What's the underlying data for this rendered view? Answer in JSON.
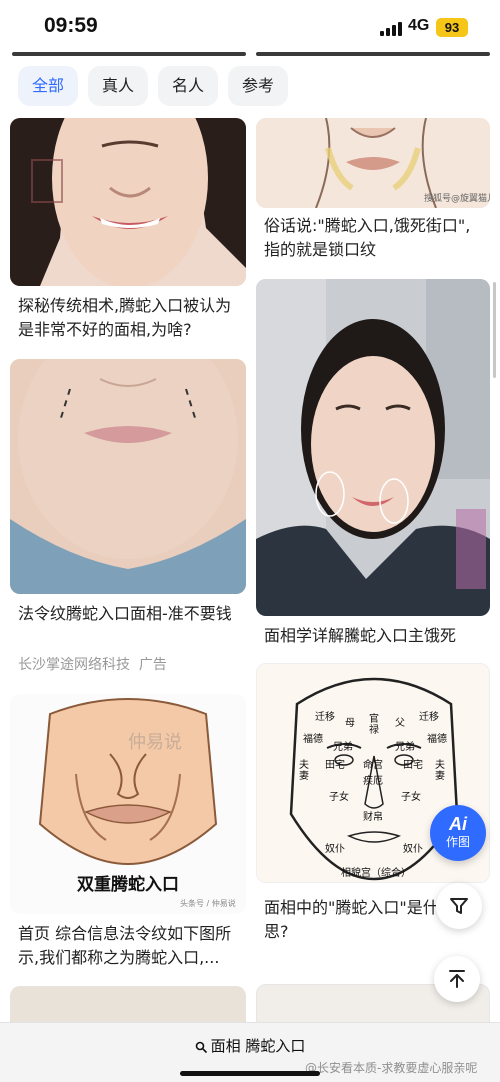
{
  "status_bar": {
    "time": "09:59",
    "network": "4G",
    "battery": "93"
  },
  "filters": [
    {
      "label": "全部",
      "active": true
    },
    {
      "label": "真人",
      "active": false
    },
    {
      "label": "名人",
      "active": false
    },
    {
      "label": "参考",
      "active": false
    }
  ],
  "cards": [
    {
      "title": "探秘传统相术,腾蛇入口被认为是非常不好的面相,为啥?",
      "image_text": ""
    },
    {
      "title": "俗话说:\"腾蛇入口,饿死街口\",指的就是锁口纹",
      "image_text": "搜狐号@旋翼猫儿"
    },
    {
      "title": "面相学详解騰蛇入口主饿死",
      "image_text": ""
    },
    {
      "title": "法令纹腾蛇入口面相-准不要钱",
      "meta": "长沙掌途网络科技  广告"
    },
    {
      "title": "面相中的\"腾蛇入口\"是什么意思?",
      "image_labels": [
        "迁移",
        "母",
        "官禄",
        "父",
        "迁移",
        "福德",
        "兄弟",
        "兄弟",
        "福德",
        "夫妻",
        "田宅",
        "命宫",
        "田宅",
        "夫妻",
        "疾厄",
        "子女",
        "子女",
        "财帛",
        "奴仆",
        "奴仆",
        "相貌宫（综合）"
      ]
    },
    {
      "title": "首页 综合信息法令纹如下图所示,我们都称之为腾蛇入口,...",
      "image_caption": "双重腾蛇入口",
      "image_watermark": "仲易说",
      "image_source": "头条号 / 仲易说"
    }
  ],
  "ai_button": {
    "mark": "Ai",
    "label": "作图"
  },
  "bottom": {
    "query": "面相 腾蛇入口",
    "watermark": "@长安看本质-求教要虚心服亲呢"
  },
  "colors": {
    "accent": "#2f6bff",
    "chip_bg": "#f2f3f5",
    "battery": "#f5c518"
  },
  "icons": [
    "search-icon",
    "filter-funnel-icon",
    "back-to-top-icon"
  ]
}
